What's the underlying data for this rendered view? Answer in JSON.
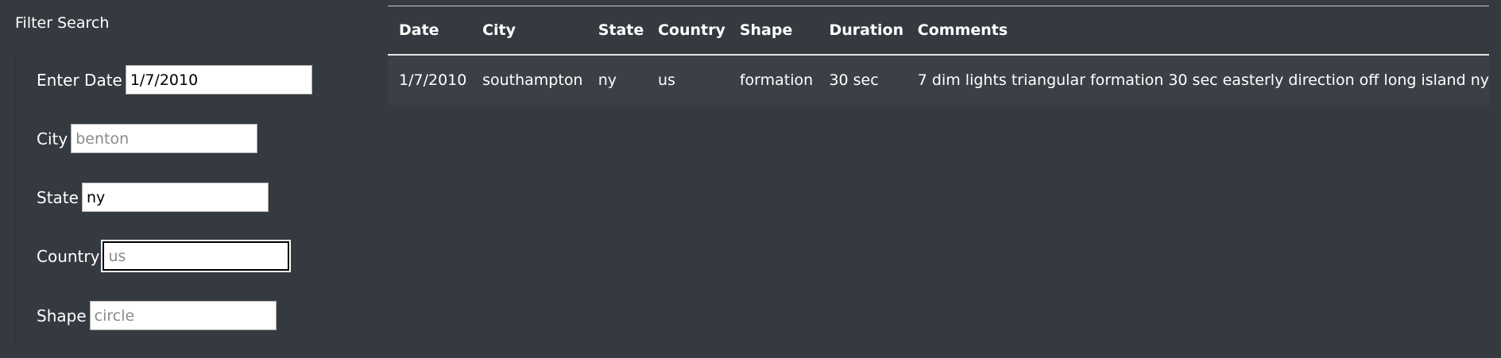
{
  "filter": {
    "title": "Filter Search",
    "fields": [
      {
        "label": "Enter Date",
        "value": "1/7/2010",
        "placeholder": ""
      },
      {
        "label": "City",
        "value": "",
        "placeholder": "benton"
      },
      {
        "label": "State",
        "value": "ny",
        "placeholder": ""
      },
      {
        "label": "Country",
        "value": "",
        "placeholder": "us"
      },
      {
        "label": "Shape",
        "value": "",
        "placeholder": "circle"
      }
    ]
  },
  "table": {
    "headers": [
      "Date",
      "City",
      "State",
      "Country",
      "Shape",
      "Duration",
      "Comments"
    ],
    "rows": [
      [
        "1/7/2010",
        "southampton",
        "ny",
        "us",
        "formation",
        "30 sec",
        "7 dim lights triangular formation 30 sec easterly direction off long island ny"
      ]
    ]
  }
}
